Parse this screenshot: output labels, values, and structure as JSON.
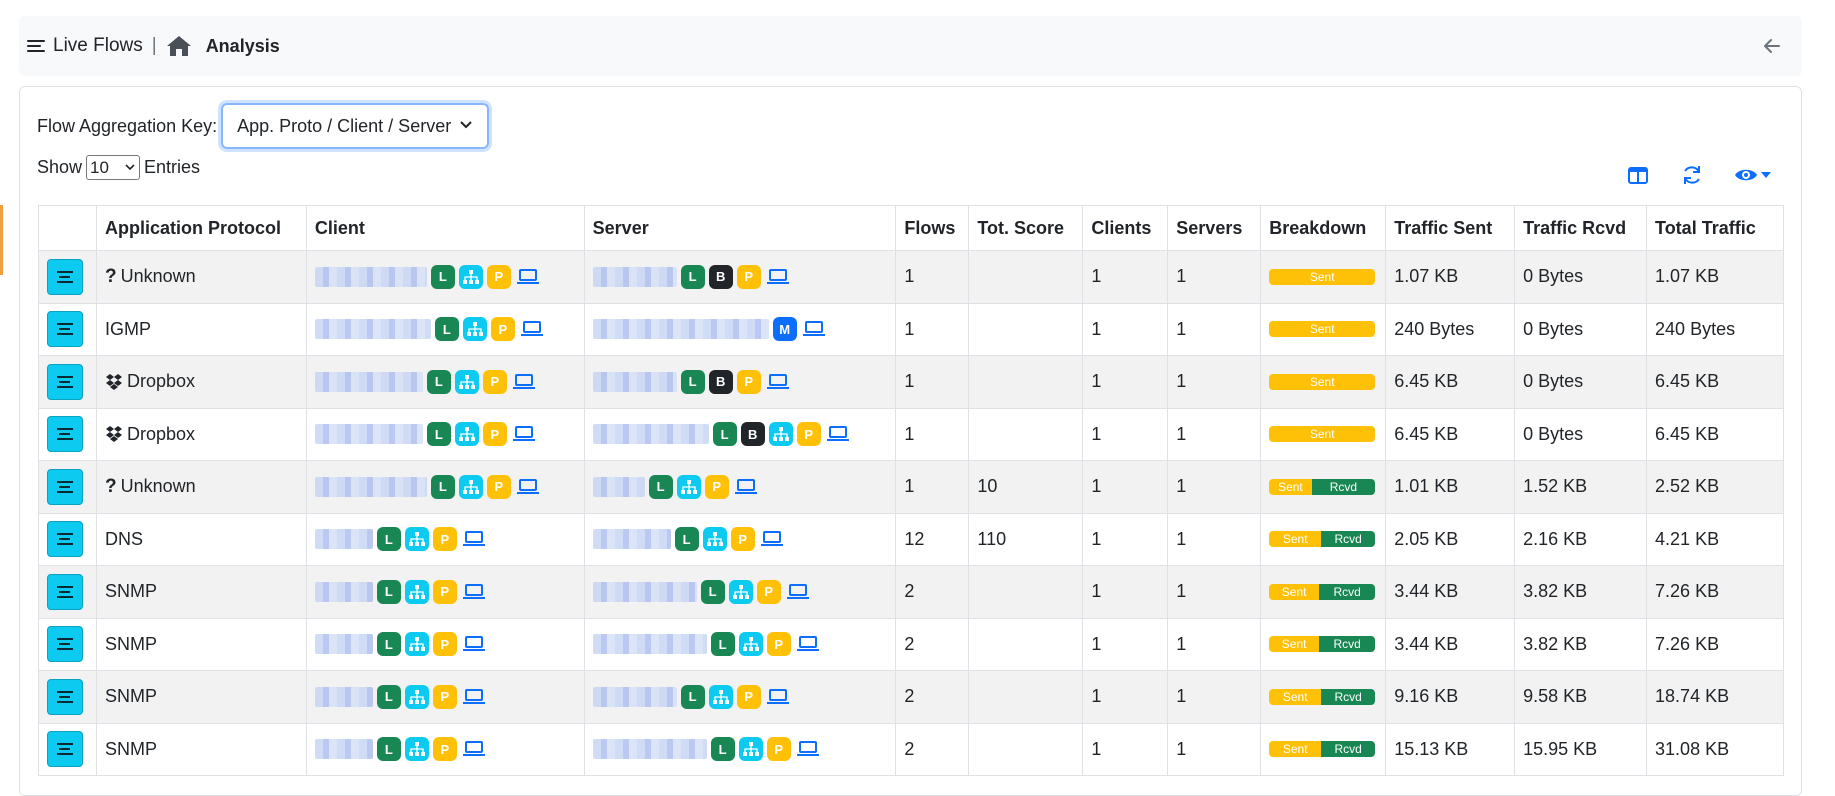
{
  "header": {
    "title": "Live Flows",
    "separator": "|",
    "page": "Analysis"
  },
  "aggregation": {
    "label": "Flow Aggregation Key:",
    "selected": "App. Proto / Client / Server"
  },
  "show": {
    "prefix": "Show",
    "value": "10",
    "suffix": "Entries"
  },
  "colors": {
    "accent": "#0dcaf0",
    "local_badge": "#198754",
    "blacklist_badge": "#212529",
    "private_badge": "#ffc107",
    "multicast_badge": "#0d6efd",
    "sent": "#ffc107",
    "rcvd": "#198754"
  },
  "table": {
    "columns": [
      "",
      "Application Protocol",
      "Client",
      "Server",
      "Flows",
      "Tot. Score",
      "Clients",
      "Servers",
      "Breakdown",
      "Traffic Sent",
      "Traffic Rcvd",
      "Total Traffic"
    ],
    "rows": [
      {
        "icon": "question",
        "proto": "Unknown",
        "client_badges": [
          "L",
          "net",
          "P",
          "laptop"
        ],
        "server_badges": [
          "L",
          "B",
          "P",
          "laptop"
        ],
        "flows": "1",
        "score": "",
        "clients": "1",
        "servers": "1",
        "sent_pct": 100,
        "sent_label": "Sent",
        "rcvd_label": "",
        "traffic_sent": "1.07 KB",
        "traffic_rcvd": "0 Bytes",
        "total": "1.07 KB"
      },
      {
        "icon": "",
        "proto": "IGMP",
        "client_badges": [
          "L",
          "net",
          "P",
          "laptop"
        ],
        "server_badges": [
          "M",
          "laptop"
        ],
        "flows": "1",
        "score": "",
        "clients": "1",
        "servers": "1",
        "sent_pct": 100,
        "sent_label": "Sent",
        "rcvd_label": "",
        "traffic_sent": "240 Bytes",
        "traffic_rcvd": "0 Bytes",
        "total": "240 Bytes"
      },
      {
        "icon": "dropbox",
        "proto": "Dropbox",
        "client_badges": [
          "L",
          "net",
          "P",
          "laptop"
        ],
        "server_badges": [
          "L",
          "B",
          "P",
          "laptop"
        ],
        "flows": "1",
        "score": "",
        "clients": "1",
        "servers": "1",
        "sent_pct": 100,
        "sent_label": "Sent",
        "rcvd_label": "",
        "traffic_sent": "6.45 KB",
        "traffic_rcvd": "0 Bytes",
        "total": "6.45 KB"
      },
      {
        "icon": "dropbox",
        "proto": "Dropbox",
        "client_badges": [
          "L",
          "net",
          "P",
          "laptop"
        ],
        "server_badges": [
          "L",
          "B",
          "net",
          "P",
          "laptop"
        ],
        "flows": "1",
        "score": "",
        "clients": "1",
        "servers": "1",
        "sent_pct": 100,
        "sent_label": "Sent",
        "rcvd_label": "",
        "traffic_sent": "6.45 KB",
        "traffic_rcvd": "0 Bytes",
        "total": "6.45 KB"
      },
      {
        "icon": "question",
        "proto": "Unknown",
        "client_badges": [
          "L",
          "net",
          "P",
          "laptop"
        ],
        "server_badges": [
          "L",
          "net",
          "P",
          "laptop"
        ],
        "flows": "1",
        "score": "10",
        "clients": "1",
        "servers": "1",
        "sent_pct": 40,
        "sent_label": "Sent",
        "rcvd_label": "Rcvd",
        "traffic_sent": "1.01 KB",
        "traffic_rcvd": "1.52 KB",
        "total": "2.52 KB"
      },
      {
        "icon": "",
        "proto": "DNS",
        "client_badges": [
          "L",
          "net",
          "P",
          "laptop"
        ],
        "server_badges": [
          "L",
          "net",
          "P",
          "laptop"
        ],
        "flows": "12",
        "score": "110",
        "clients": "1",
        "servers": "1",
        "sent_pct": 49,
        "sent_label": "Sent",
        "rcvd_label": "Rcvd",
        "traffic_sent": "2.05 KB",
        "traffic_rcvd": "2.16 KB",
        "total": "4.21 KB"
      },
      {
        "icon": "",
        "proto": "SNMP",
        "client_badges": [
          "L",
          "net",
          "P",
          "laptop"
        ],
        "server_badges": [
          "L",
          "net",
          "P",
          "laptop"
        ],
        "flows": "2",
        "score": "",
        "clients": "1",
        "servers": "1",
        "sent_pct": 47,
        "sent_label": "Sent",
        "rcvd_label": "Rcvd",
        "traffic_sent": "3.44 KB",
        "traffic_rcvd": "3.82 KB",
        "total": "7.26 KB"
      },
      {
        "icon": "",
        "proto": "SNMP",
        "client_badges": [
          "L",
          "net",
          "P",
          "laptop"
        ],
        "server_badges": [
          "L",
          "net",
          "P",
          "laptop"
        ],
        "flows": "2",
        "score": "",
        "clients": "1",
        "servers": "1",
        "sent_pct": 47,
        "sent_label": "Sent",
        "rcvd_label": "Rcvd",
        "traffic_sent": "3.44 KB",
        "traffic_rcvd": "3.82 KB",
        "total": "7.26 KB"
      },
      {
        "icon": "",
        "proto": "SNMP",
        "client_badges": [
          "L",
          "net",
          "P",
          "laptop"
        ],
        "server_badges": [
          "L",
          "net",
          "P",
          "laptop"
        ],
        "flows": "2",
        "score": "",
        "clients": "1",
        "servers": "1",
        "sent_pct": 49,
        "sent_label": "Sent",
        "rcvd_label": "Rcvd",
        "traffic_sent": "9.16 KB",
        "traffic_rcvd": "9.58 KB",
        "total": "18.74 KB"
      },
      {
        "icon": "",
        "proto": "SNMP",
        "client_badges": [
          "L",
          "net",
          "P",
          "laptop"
        ],
        "server_badges": [
          "L",
          "net",
          "P",
          "laptop"
        ],
        "flows": "2",
        "score": "",
        "clients": "1",
        "servers": "1",
        "sent_pct": 49,
        "sent_label": "Sent",
        "rcvd_label": "Rcvd",
        "traffic_sent": "15.13 KB",
        "traffic_rcvd": "15.95 KB",
        "total": "31.08 KB"
      }
    ]
  }
}
